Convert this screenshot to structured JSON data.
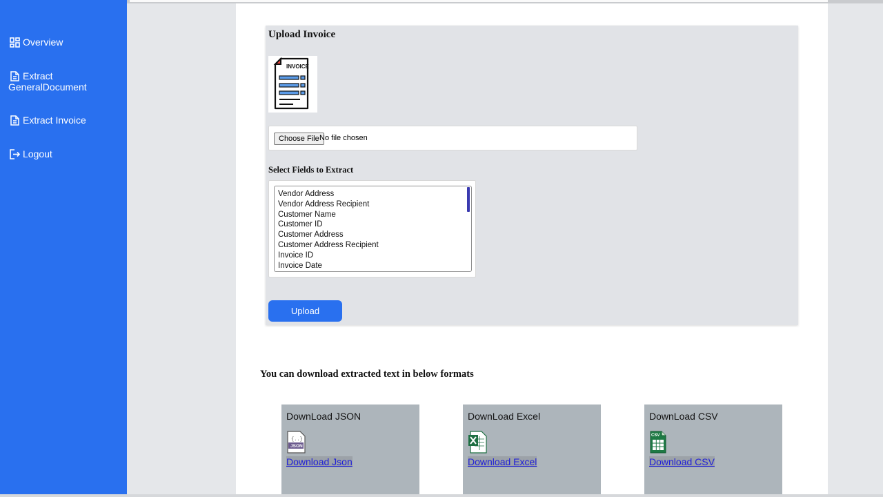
{
  "sidebar": {
    "items": [
      {
        "label": "Overview",
        "icon": "dashboard-icon"
      },
      {
        "label": "Extract\nGeneralDocument",
        "icon": "document-icon"
      },
      {
        "label": "Extract Invoice",
        "icon": "document-icon"
      },
      {
        "label": "Logout",
        "icon": "logout-icon"
      }
    ]
  },
  "upload": {
    "title": "Upload Invoice",
    "image_text": "INVOICE",
    "choose_label": "Choose File",
    "file_status": "No file chosen",
    "fields_label": "Select Fields to Extract",
    "fields": [
      "Vendor Address",
      "Vendor Address Recipient",
      "Customer Name",
      "Customer ID",
      "Customer Address",
      "Customer Address Recipient",
      "Invoice ID",
      "Invoice Date"
    ],
    "upload_label": "Upload"
  },
  "downloads": {
    "heading": "You can download extracted text in below formats",
    "cards": [
      {
        "title": "DownLoad JSON",
        "link": "Download Json",
        "icon": "json-file-icon"
      },
      {
        "title": "DownLoad Excel",
        "link": "Download Excel",
        "icon": "excel-file-icon"
      },
      {
        "title": "DownLoad CSV",
        "link": "Download CSV",
        "icon": "csv-file-icon"
      }
    ]
  },
  "colors": {
    "sidebar": "#2970ef",
    "accent": "#2970ef",
    "card": "#adb5bb"
  }
}
